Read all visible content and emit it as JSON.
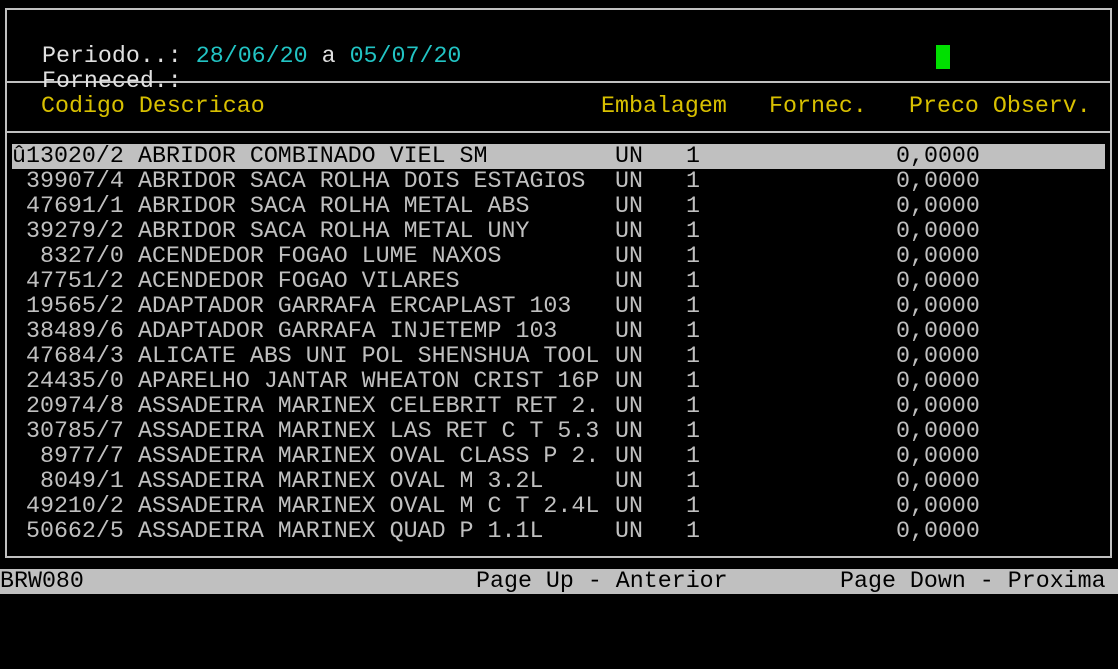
{
  "header": {
    "period_label": "Periodo..:",
    "period_start": "28/06/20",
    "period_sep": "a",
    "period_end": "05/07/20",
    "supplier_label": "Forneced.:",
    "supplier_value": ""
  },
  "columns": {
    "code_desc": "Codigo Descricao",
    "packaging": "Embalagem",
    "supplier": "Fornec.",
    "price_obs": "Preco Observ."
  },
  "rows": [
    {
      "code": "û13020/2",
      "desc": "ABRIDOR COMBINADO VIEL SM",
      "emb": "UN",
      "qty": "1",
      "price": "0,0000"
    },
    {
      "code": " 39907/4",
      "desc": "ABRIDOR SACA ROLHA DOIS ESTAGIOS",
      "emb": "UN",
      "qty": "1",
      "price": "0,0000"
    },
    {
      "code": " 47691/1",
      "desc": "ABRIDOR SACA ROLHA METAL ABS",
      "emb": "UN",
      "qty": "1",
      "price": "0,0000"
    },
    {
      "code": " 39279/2",
      "desc": "ABRIDOR SACA ROLHA METAL UNY",
      "emb": "UN",
      "qty": "1",
      "price": "0,0000"
    },
    {
      "code": "  8327/0",
      "desc": "ACENDEDOR FOGAO LUME NAXOS",
      "emb": "UN",
      "qty": "1",
      "price": "0,0000"
    },
    {
      "code": " 47751/2",
      "desc": "ACENDEDOR FOGAO VILARES",
      "emb": "UN",
      "qty": "1",
      "price": "0,0000"
    },
    {
      "code": " 19565/2",
      "desc": "ADAPTADOR GARRAFA ERCAPLAST 103",
      "emb": "UN",
      "qty": "1",
      "price": "0,0000"
    },
    {
      "code": " 38489/6",
      "desc": "ADAPTADOR GARRAFA INJETEMP 103",
      "emb": "UN",
      "qty": "1",
      "price": "0,0000"
    },
    {
      "code": " 47684/3",
      "desc": "ALICATE ABS UNI POL SHENSHUA TOOL",
      "emb": "UN",
      "qty": "1",
      "price": "0,0000"
    },
    {
      "code": " 24435/0",
      "desc": "APARELHO JANTAR WHEATON CRIST 16P",
      "emb": "UN",
      "qty": "1",
      "price": "0,0000"
    },
    {
      "code": " 20974/8",
      "desc": "ASSADEIRA MARINEX CELEBRIT RET 2.",
      "emb": "UN",
      "qty": "1",
      "price": "0,0000"
    },
    {
      "code": " 30785/7",
      "desc": "ASSADEIRA MARINEX LAS RET C T 5.3",
      "emb": "UN",
      "qty": "1",
      "price": "0,0000"
    },
    {
      "code": "  8977/7",
      "desc": "ASSADEIRA MARINEX OVAL CLASS P 2.",
      "emb": "UN",
      "qty": "1",
      "price": "0,0000"
    },
    {
      "code": "  8049/1",
      "desc": "ASSADEIRA MARINEX OVAL M 3.2L",
      "emb": "UN",
      "qty": "1",
      "price": "0,0000"
    },
    {
      "code": " 49210/2",
      "desc": "ASSADEIRA MARINEX OVAL M C T 2.4L",
      "emb": "UN",
      "qty": "1",
      "price": "0,0000"
    },
    {
      "code": " 50662/5",
      "desc": "ASSADEIRA MARINEX QUAD P 1.1L",
      "emb": "UN",
      "qty": "1",
      "price": "0,0000"
    }
  ],
  "status": {
    "program": "BRW080",
    "page_up": "Page Up - Anterior",
    "page_down": "Page Down - Proxima"
  },
  "colors": {
    "background": "#000000",
    "text": "#c0c0c0",
    "date": "#22c4c4",
    "column_header": "#d8c000",
    "cursor": "#00e000",
    "selection": "#c0c0c0"
  }
}
